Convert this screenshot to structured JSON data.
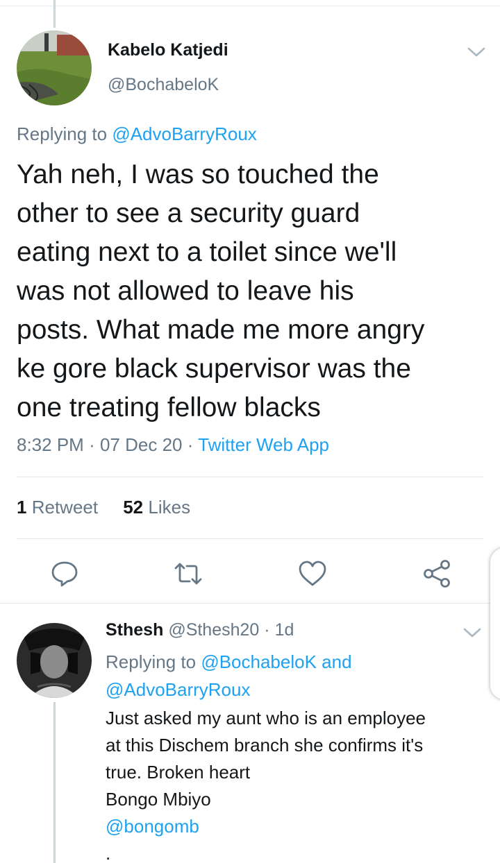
{
  "main_tweet": {
    "display_name": "Kabelo Katjedi",
    "handle": "@BochabeloK",
    "replying_prefix": "Replying to",
    "replying_to": "@AdvoBarryRoux",
    "text_lines": [
      "Yah neh, I was so touched the",
      "other to see a security guard",
      "eating next to a toilet since we'll",
      "was not allowed to leave his",
      "posts. What made me more angry",
      "ke gore black supervisor was the",
      "one treating fellow blacks"
    ],
    "time": "8:32 PM",
    "date": "07 Dec 20",
    "source": "Twitter Web App",
    "retweets_count": "1",
    "retweets_label": "Retweet",
    "likes_count": "52",
    "likes_label": "Likes"
  },
  "actions": [
    "reply-icon",
    "retweet-icon",
    "like-icon",
    "share-icon"
  ],
  "reply_tweet": {
    "display_name": "Sthesh",
    "handle": "@Sthesh20",
    "age": "1d",
    "replying_prefix": "Replying to",
    "replying_to_1": "@BochabeloK",
    "replying_and": "and",
    "replying_to_2": "@AdvoBarryRoux",
    "lines": [
      "Just asked my aunt who is an employee",
      "at this Dischem branch she confirms it's",
      "true. Broken heart",
      "Bongo Mbiyo"
    ],
    "link": "@bongomb",
    "trailing": "."
  },
  "colors": {
    "accent": "#1da1f2",
    "secondary_text": "#657786",
    "primary_text": "#14171a",
    "divider": "#e1e8ed"
  }
}
